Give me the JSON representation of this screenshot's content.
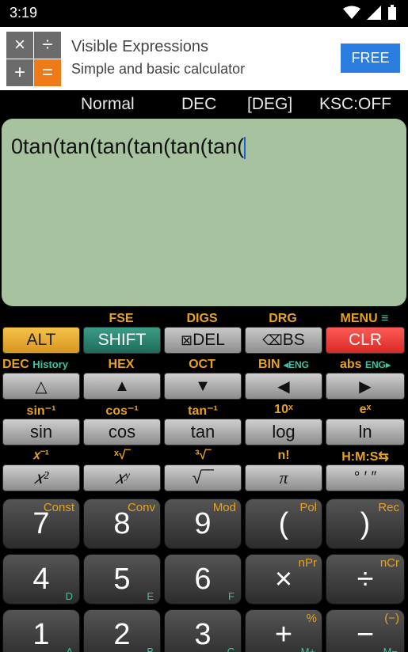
{
  "status": {
    "time": "3:19"
  },
  "ad": {
    "title": "Visible Expressions",
    "subtitle": "Simple and basic calculator",
    "button": "FREE",
    "logo": [
      "×",
      "÷",
      "+",
      "="
    ]
  },
  "mode": {
    "normal": "Normal",
    "base": "DEC",
    "angle": "[DEG]",
    "ksc": "KSC:OFF"
  },
  "display": {
    "expression": "0tan(tan(tan(tan(tan(tan("
  },
  "row1_labels": {
    "fse": "FSE",
    "digs": "DIGS",
    "drg": "DRG",
    "menu": "MENU"
  },
  "row1": {
    "alt": "ALT",
    "shift": "SHIFT",
    "del": "DEL",
    "bs": "BS",
    "clr": "CLR"
  },
  "row2_labels": {
    "dec": "DEC",
    "history": "History",
    "hex": "HEX",
    "oct": "OCT",
    "bin": "BIN",
    "bin_eng": "◂ENG",
    "abs": "abs",
    "abs_eng": "ENG▸"
  },
  "row3_labels": {
    "asin": "sin⁻¹",
    "acos": "cos⁻¹",
    "atan": "tan⁻¹",
    "pow10": "10ˣ",
    "exp": "eˣ"
  },
  "row3": {
    "sin": "sin",
    "cos": "cos",
    "tan": "tan",
    "log": "log",
    "ln": "ln"
  },
  "row4_labels": {
    "inv": "𝑥⁻¹",
    "xroot": "ˣ√‾",
    "croot": "³√‾",
    "fact": "n!",
    "hms": "H:M:S⇆"
  },
  "row4": {
    "sq": "𝑥²",
    "pow": "𝑥ʸ",
    "sqrt": "√‾‾",
    "pi": "π",
    "deg": "° ′ ″"
  },
  "num1": [
    {
      "main": "7",
      "sup": "Const"
    },
    {
      "main": "8",
      "sup": "Conv"
    },
    {
      "main": "9",
      "sup": "Mod"
    },
    {
      "main": "(",
      "sup": "Pol"
    },
    {
      "main": ")",
      "sup": "Rec"
    }
  ],
  "num2": [
    {
      "main": "4",
      "sub": "D"
    },
    {
      "main": "5",
      "sub": "E"
    },
    {
      "main": "6",
      "sub": "F"
    },
    {
      "main": "×",
      "sup": "nPr"
    },
    {
      "main": "÷",
      "sup": "nCr"
    }
  ],
  "num3": [
    {
      "main": "1",
      "sub": "A"
    },
    {
      "main": "2",
      "sub": "B"
    },
    {
      "main": "3",
      "sub": "C"
    },
    {
      "main": "+",
      "sup": "%",
      "sub": "M+"
    },
    {
      "main": "−",
      "sup": "(−)",
      "sub": "M−"
    }
  ]
}
